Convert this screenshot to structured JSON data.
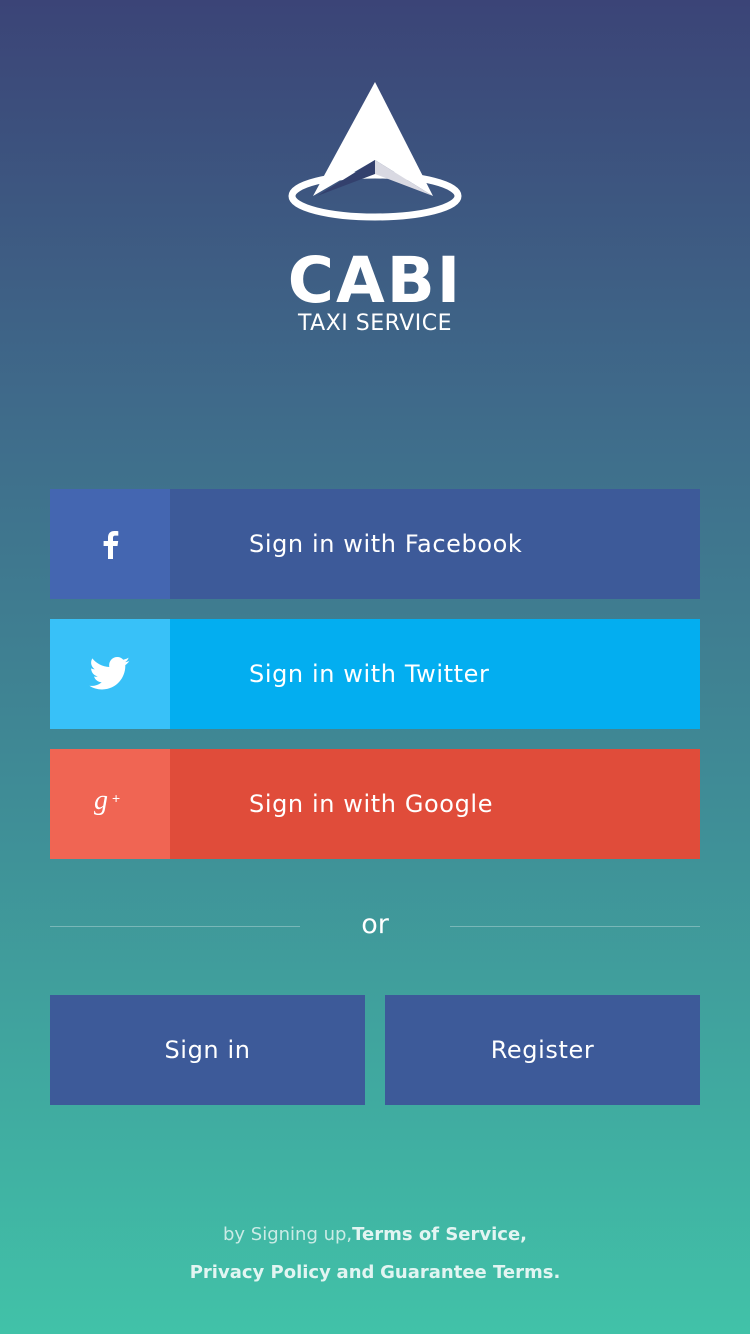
{
  "brand": {
    "name": "CABI",
    "tagline": "TAXI SERVICE"
  },
  "social": {
    "facebook": {
      "label": "Sign in with Facebook",
      "icon": "facebook-icon",
      "color": "#3d5a99"
    },
    "twitter": {
      "label": "Sign in with Twitter",
      "icon": "twitter-icon",
      "color": "#03aef0"
    },
    "google": {
      "label": "Sign in with Google",
      "icon": "google-plus-icon",
      "color": "#e04c3a"
    }
  },
  "divider": {
    "text": "or"
  },
  "actions": {
    "signin_label": "Sign in",
    "register_label": "Register"
  },
  "footer": {
    "prefix": "by Signing up,",
    "terms_link": "Terms of Service,",
    "privacy_link": "Privacy Policy",
    "and_text": "and",
    "guarantee_link": "Guarantee Terms."
  }
}
